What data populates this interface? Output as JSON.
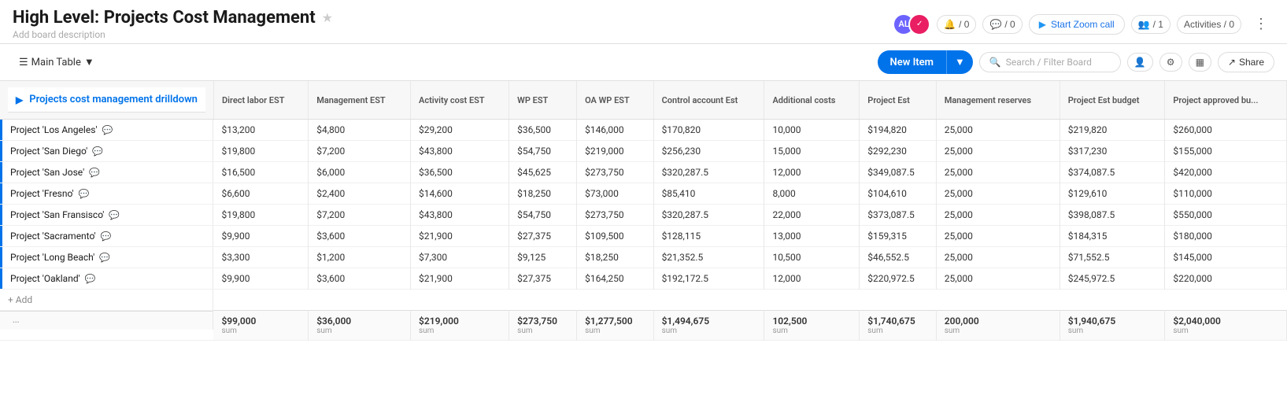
{
  "header": {
    "title": "High Level: Projects Cost Management",
    "star_label": "★",
    "board_desc": "Add board description",
    "avatar_initials": "AL",
    "activities_label": "Activities / 0",
    "users_label": "/ 1",
    "chat_label": "/ 0",
    "bell_label": "/ 0",
    "zoom_label": "Start Zoom call"
  },
  "toolbar": {
    "main_table_label": "Main Table",
    "new_item_label": "New Item",
    "search_placeholder": "Search / Filter Board",
    "share_label": "Share"
  },
  "table": {
    "group_title": "Projects cost management drilldown",
    "columns": [
      {
        "key": "name",
        "label": ""
      },
      {
        "key": "direct_labor",
        "label": "Direct labor EST"
      },
      {
        "key": "mgmt_est",
        "label": "Management EST"
      },
      {
        "key": "activity_cost",
        "label": "Activity cost EST"
      },
      {
        "key": "wp_est",
        "label": "WP EST"
      },
      {
        "key": "oa_wp_est",
        "label": "OA WP EST"
      },
      {
        "key": "control_account",
        "label": "Control account Est"
      },
      {
        "key": "additional_costs",
        "label": "Additional costs"
      },
      {
        "key": "project_est",
        "label": "Project Est"
      },
      {
        "key": "mgmt_reserves",
        "label": "Management reserves"
      },
      {
        "key": "project_est_budget",
        "label": "Project Est budget"
      },
      {
        "key": "project_approved",
        "label": "Project approved bu..."
      }
    ],
    "rows": [
      {
        "name": "Project 'Los Angeles'",
        "direct_labor": "$13,200",
        "mgmt_est": "$4,800",
        "activity_cost": "$29,200",
        "wp_est": "$36,500",
        "oa_wp_est": "$146,000",
        "control_account": "$170,820",
        "additional_costs": "10,000",
        "project_est": "$194,820",
        "mgmt_reserves": "25,000",
        "project_est_budget": "$219,820",
        "project_approved": "$260,000"
      },
      {
        "name": "Project 'San Diego'",
        "direct_labor": "$19,800",
        "mgmt_est": "$7,200",
        "activity_cost": "$43,800",
        "wp_est": "$54,750",
        "oa_wp_est": "$219,000",
        "control_account": "$256,230",
        "additional_costs": "15,000",
        "project_est": "$292,230",
        "mgmt_reserves": "25,000",
        "project_est_budget": "$317,230",
        "project_approved": "$155,000"
      },
      {
        "name": "Project 'San Jose'",
        "direct_labor": "$16,500",
        "mgmt_est": "$6,000",
        "activity_cost": "$36,500",
        "wp_est": "$45,625",
        "oa_wp_est": "$273,750",
        "control_account": "$320,287.5",
        "additional_costs": "12,000",
        "project_est": "$349,087.5",
        "mgmt_reserves": "25,000",
        "project_est_budget": "$374,087.5",
        "project_approved": "$420,000"
      },
      {
        "name": "Project 'Fresno'",
        "direct_labor": "$6,600",
        "mgmt_est": "$2,400",
        "activity_cost": "$14,600",
        "wp_est": "$18,250",
        "oa_wp_est": "$73,000",
        "control_account": "$85,410",
        "additional_costs": "8,000",
        "project_est": "$104,610",
        "mgmt_reserves": "25,000",
        "project_est_budget": "$129,610",
        "project_approved": "$110,000"
      },
      {
        "name": "Project 'San Fransisco'",
        "direct_labor": "$19,800",
        "mgmt_est": "$7,200",
        "activity_cost": "$43,800",
        "wp_est": "$54,750",
        "oa_wp_est": "$273,750",
        "control_account": "$320,287.5",
        "additional_costs": "22,000",
        "project_est": "$373,087.5",
        "mgmt_reserves": "25,000",
        "project_est_budget": "$398,087.5",
        "project_approved": "$550,000"
      },
      {
        "name": "Project 'Sacramento'",
        "direct_labor": "$9,900",
        "mgmt_est": "$3,600",
        "activity_cost": "$21,900",
        "wp_est": "$27,375",
        "oa_wp_est": "$109,500",
        "control_account": "$128,115",
        "additional_costs": "13,000",
        "project_est": "$159,315",
        "mgmt_reserves": "25,000",
        "project_est_budget": "$184,315",
        "project_approved": "$180,000"
      },
      {
        "name": "Project 'Long Beach'",
        "direct_labor": "$3,300",
        "mgmt_est": "$1,200",
        "activity_cost": "$7,300",
        "wp_est": "$9,125",
        "oa_wp_est": "$18,250",
        "control_account": "$21,352.5",
        "additional_costs": "10,500",
        "project_est": "$46,552.5",
        "mgmt_reserves": "25,000",
        "project_est_budget": "$71,552.5",
        "project_approved": "$145,000"
      },
      {
        "name": "Project 'Oakland'",
        "direct_labor": "$9,900",
        "mgmt_est": "$3,600",
        "activity_cost": "$21,900",
        "wp_est": "$27,375",
        "oa_wp_est": "$164,250",
        "control_account": "$192,172.5",
        "additional_costs": "12,000",
        "project_est": "$220,972.5",
        "mgmt_reserves": "25,000",
        "project_est_budget": "$245,972.5",
        "project_approved": "$220,000"
      }
    ],
    "sums": {
      "direct_labor": "$99,000",
      "mgmt_est": "$36,000",
      "activity_cost": "$219,000",
      "wp_est": "$273,750",
      "oa_wp_est": "$1,277,500",
      "control_account": "$1,494,675",
      "additional_costs": "102,500",
      "project_est": "$1,740,675",
      "mgmt_reserves": "200,000",
      "project_est_budget": "$1,940,675",
      "project_approved": "$2,040,000"
    },
    "add_label": "+ Add"
  }
}
